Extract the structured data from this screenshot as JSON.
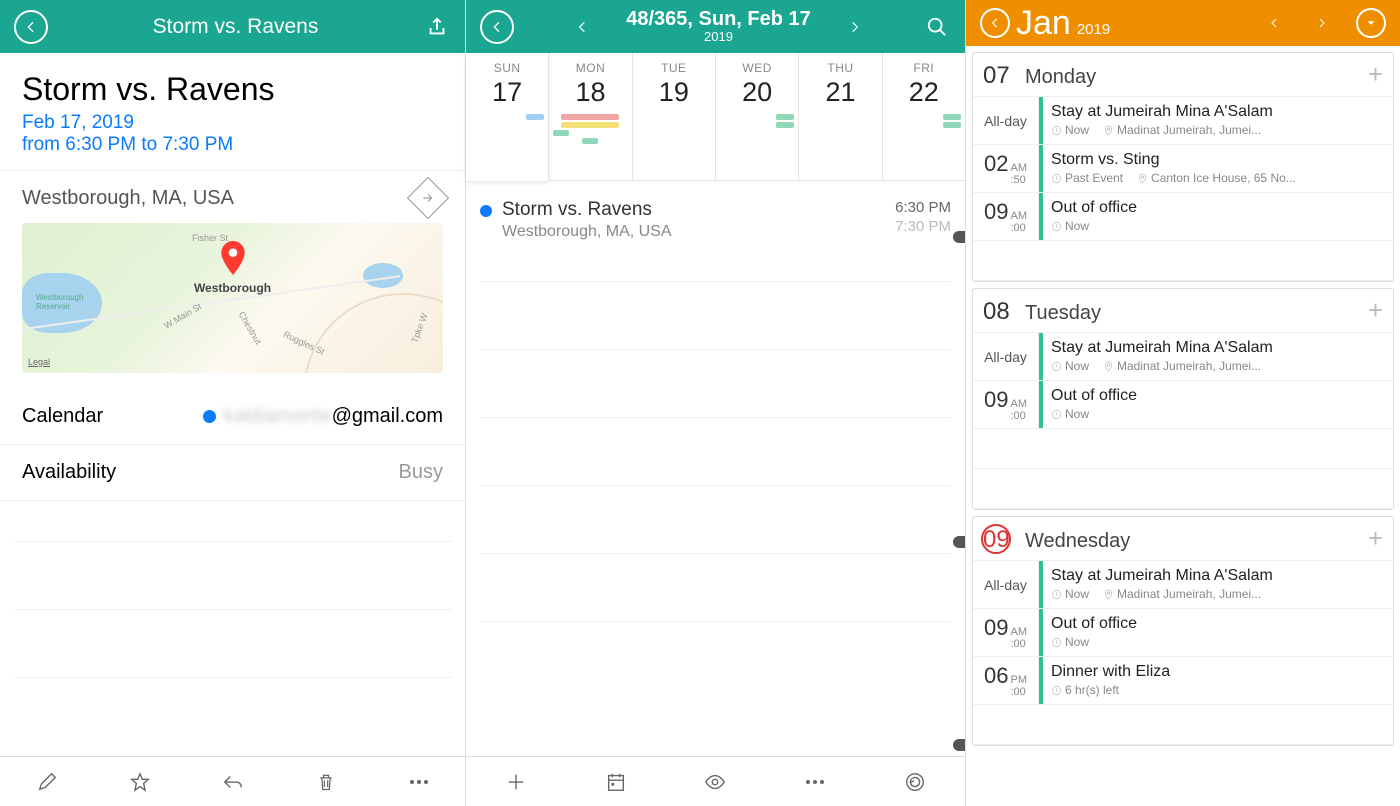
{
  "left": {
    "header_title": "Storm vs. Ravens",
    "event_title": "Storm vs. Ravens",
    "event_date": "Feb 17, 2019",
    "event_time": "from 6:30 PM to 7:30 PM",
    "location": "Westborough, MA, USA",
    "map_label": "Westborough",
    "legal": "Legal",
    "calendar_label": "Calendar",
    "calendar_account_blur": "kaldiamonte",
    "calendar_account_suffix": "@gmail.com",
    "availability_label": "Availability",
    "availability_value": "Busy"
  },
  "mid": {
    "header_line1": "48/365, Sun, Feb 17",
    "header_line2": "2019",
    "days": [
      {
        "dow": "SUN",
        "num": "17",
        "sel": true,
        "chips": [
          {
            "c": "#9fcff3",
            "w": 18,
            "a": "end"
          }
        ]
      },
      {
        "dow": "MON",
        "num": "18",
        "sel": false,
        "chips": [
          {
            "c": "#f2a5a5",
            "w": 58
          },
          {
            "c": "#f5e17a",
            "w": 58
          },
          {
            "c": "#8fd9b8",
            "w": 16,
            "a": "start"
          },
          {
            "c": "#8fd9b8",
            "w": 16
          }
        ]
      },
      {
        "dow": "TUE",
        "num": "19",
        "sel": false,
        "chips": []
      },
      {
        "dow": "WED",
        "num": "20",
        "sel": false,
        "chips": [
          {
            "c": "#8fd9b8",
            "w": 18,
            "a": "end"
          },
          {
            "c": "#8fd9b8",
            "w": 18,
            "a": "end"
          }
        ]
      },
      {
        "dow": "THU",
        "num": "21",
        "sel": false,
        "chips": []
      },
      {
        "dow": "FRI",
        "num": "22",
        "sel": false,
        "chips": [
          {
            "c": "#8fd9b8",
            "w": 18,
            "a": "end"
          },
          {
            "c": "#8fd9b8",
            "w": 18,
            "a": "end"
          }
        ]
      }
    ],
    "event": {
      "name": "Storm vs. Ravens",
      "loc": "Westborough, MA, USA",
      "t1": "6:30 PM",
      "t2": "7:30 PM"
    }
  },
  "right": {
    "month": "Jan",
    "year": "2019",
    "days": [
      {
        "num": "07",
        "name": "Monday",
        "today": false,
        "rows": [
          {
            "time_type": "allday",
            "label": "All-day",
            "title": "Stay at Jumeirah Mina A'Salam",
            "meta": [
              {
                "icon": "clock",
                "text": "Now"
              },
              {
                "icon": "pin",
                "text": "Madinat Jumeirah, Jumei..."
              }
            ]
          },
          {
            "time_type": "hm",
            "h": "02",
            "ap": "AM",
            "m": ":50",
            "title": "Storm vs. Sting",
            "meta": [
              {
                "icon": "clock",
                "text": "Past Event"
              },
              {
                "icon": "pin",
                "text": "Canton Ice House, 65 No..."
              }
            ]
          },
          {
            "time_type": "hm",
            "h": "09",
            "ap": "AM",
            "m": ":00",
            "title": "Out of office",
            "meta": [
              {
                "icon": "clock",
                "text": "Now"
              }
            ]
          }
        ],
        "pad": 1
      },
      {
        "num": "08",
        "name": "Tuesday",
        "today": false,
        "rows": [
          {
            "time_type": "allday",
            "label": "All-day",
            "title": "Stay at Jumeirah Mina A'Salam",
            "meta": [
              {
                "icon": "clock",
                "text": "Now"
              },
              {
                "icon": "pin",
                "text": "Madinat Jumeirah, Jumei..."
              }
            ]
          },
          {
            "time_type": "hm",
            "h": "09",
            "ap": "AM",
            "m": ":00",
            "title": "Out of office",
            "meta": [
              {
                "icon": "clock",
                "text": "Now"
              }
            ]
          }
        ],
        "pad": 2
      },
      {
        "num": "09",
        "name": "Wednesday",
        "today": true,
        "rows": [
          {
            "time_type": "allday",
            "label": "All-day",
            "title": "Stay at Jumeirah Mina A'Salam",
            "meta": [
              {
                "icon": "clock",
                "text": "Now"
              },
              {
                "icon": "pin",
                "text": "Madinat Jumeirah, Jumei..."
              }
            ]
          },
          {
            "time_type": "hm",
            "h": "09",
            "ap": "AM",
            "m": ":00",
            "title": "Out of office",
            "meta": [
              {
                "icon": "clock",
                "text": "Now"
              }
            ]
          },
          {
            "time_type": "hm",
            "h": "06",
            "ap": "PM",
            "m": ":00",
            "title": "Dinner with Eliza",
            "meta": [
              {
                "icon": "clock",
                "text": "6 hr(s) left"
              }
            ]
          }
        ],
        "pad": 1
      }
    ]
  }
}
